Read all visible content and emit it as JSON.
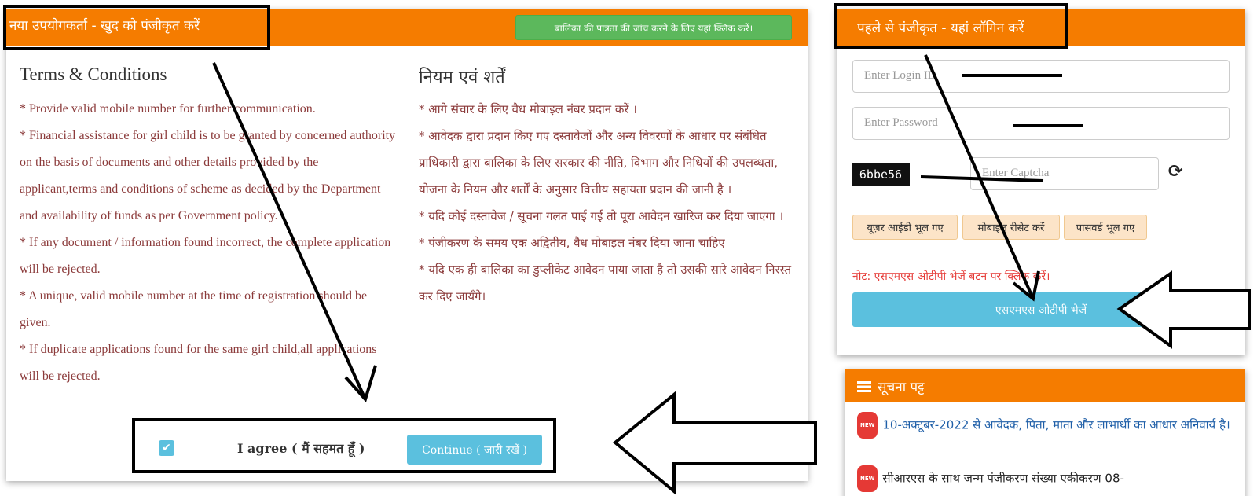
{
  "registration": {
    "title": "नया उपयोगकर्ता - खुद को पंजीकृत करें",
    "eligibility_button": "बालिका की पात्रता की जांच करने के लिए यहां क्लिक करें।",
    "terms_en": {
      "heading": "Terms & Conditions",
      "items": [
        "* Provide valid mobile number for further communication.",
        "* Financial assistance for girl child is to be granted by concerned authority on the basis of documents and other details provided by the applicant,terms and conditions of scheme as decided by the Department and availability of funds as per Government policy.",
        "* If any document / information found incorrect, the complete application will be rejected.",
        "* A unique, valid mobile number at the time of registration should be given.",
        "* If duplicate applications found for the same girl child,all applications will be rejected."
      ]
    },
    "terms_hi": {
      "heading": "नियम एवं शर्तें",
      "items": [
        "* आगे संचार के लिए वैध मोबाइल नंबर प्रदान करें ।",
        "* आवेदक द्वारा प्रदान किए गए दस्तावेजों और अन्य विवरणों के आधार पर संबंधित प्राधिकारी द्वारा बालिका के लिए सरकार की नीति, विभाग और निधियों की उपलब्धता, योजना के नियम और शर्तों के अनुसार वित्तीय सहायता प्रदान की जानी है ।",
        "* यदि कोई दस्तावेज / सूचना गलत पाई गई तो पूरा आवेदन खारिज कर दिया जाएगा ।",
        "* पंजीकरण के समय एक अद्वितीय, वैध मोबाइल नंबर दिया जाना चाहिए",
        "* यदि एक ही बालिका का डुप्लीकेट आवेदन पाया जाता है तो उसकी सारे आवेदन निरस्त कर दिए जायँगे।"
      ]
    },
    "agree_label": "I agree ( मैं सहमत हूँ )",
    "agree_checked": true,
    "continue_button": "Continue ( जारी रखें )"
  },
  "login": {
    "title": "पहले से पंजीकृत - यहां लॉगिन करें",
    "login_id_placeholder": "Enter Login ID",
    "password_placeholder": "Enter Password",
    "captcha_text": "6bbe56",
    "captcha_placeholder": "Enter Captcha",
    "forgot_user_button": "यूज़र आईडी भूल गए",
    "reset_mobile_button": "मोबाइल रीसेट करें",
    "forgot_password_button": "पासवर्ड भूल गए",
    "note": "नोट: एसएमएस ओटीपी भेजें बटन पर क्लिक करें।",
    "otp_button": "एसएमएस ओटीपी भेजें"
  },
  "notice": {
    "title": "सूचना पट्ट",
    "badge": "NEW",
    "items": [
      "10-अक्टूबर-2022 से आवेदक, पिता, माता और लाभार्थी का आधार अनिवार्य है।",
      "सीआरएस के साथ जन्म पंजीकरण संख्या एकीकरण 08-"
    ]
  },
  "colors": {
    "header_orange": "#f57c00",
    "info_blue": "#5bc0de",
    "success_green": "#5cb85c",
    "terms_text": "#8b3a3a",
    "note_red": "#e53935"
  }
}
